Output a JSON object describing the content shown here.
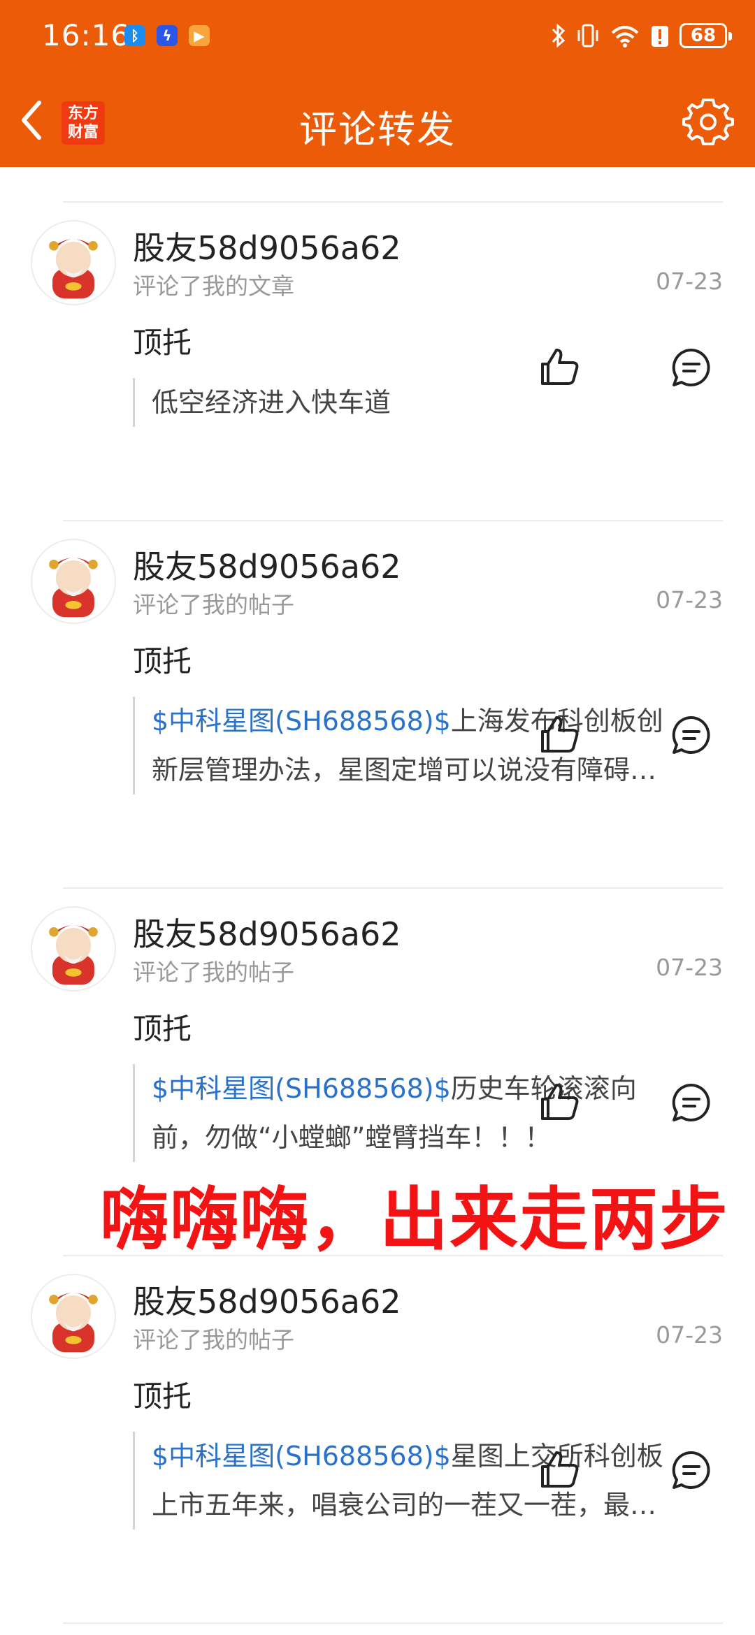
{
  "status_bar": {
    "time": "16:16",
    "battery": "68",
    "icons": [
      "bluetooth-icon",
      "vibrate-icon",
      "wifi-icon",
      "alert-icon",
      "battery-icon"
    ]
  },
  "app_bar": {
    "logo_line1": "东方",
    "logo_line2": "财富",
    "title": "评论转发"
  },
  "posts": [
    {
      "username": "股友58d9056a62",
      "action": "评论了我的文章",
      "date": "07-23",
      "comment": "顶托",
      "quote_line1_link": "",
      "quote_line1_text": "低空经济进入快车道",
      "quote_line2": ""
    },
    {
      "username": "股友58d9056a62",
      "action": "评论了我的帖子",
      "date": "07-23",
      "comment": "顶托",
      "quote_line1_link": "$中科星图(SH688568)$",
      "quote_line1_text": "上海发布科创板创",
      "quote_line2": "新层管理办法，星图定增可以说没有障碍…"
    },
    {
      "username": "股友58d9056a62",
      "action": "评论了我的帖子",
      "date": "07-23",
      "comment": "顶托",
      "quote_line1_link": "$中科星图(SH688568)$",
      "quote_line1_text": "历史车轮滚滚向",
      "quote_line2": "前，勿做“小螳螂”螳臂挡车！！！"
    },
    {
      "username": "股友58d9056a62",
      "action": "评论了我的帖子",
      "date": "07-23",
      "comment": "顶托",
      "quote_line1_link": "$中科星图(SH688568)$",
      "quote_line1_text": "星图上交所科创板",
      "quote_line2": "上市五年来，唱衰公司的一茬又一茬，最…"
    }
  ],
  "overlay_caption": "嗨嗨嗨，出来走两步",
  "colors": {
    "brand_orange": "#ec5b08",
    "link_blue": "#2a72c9",
    "caption_red": "#f21414"
  }
}
